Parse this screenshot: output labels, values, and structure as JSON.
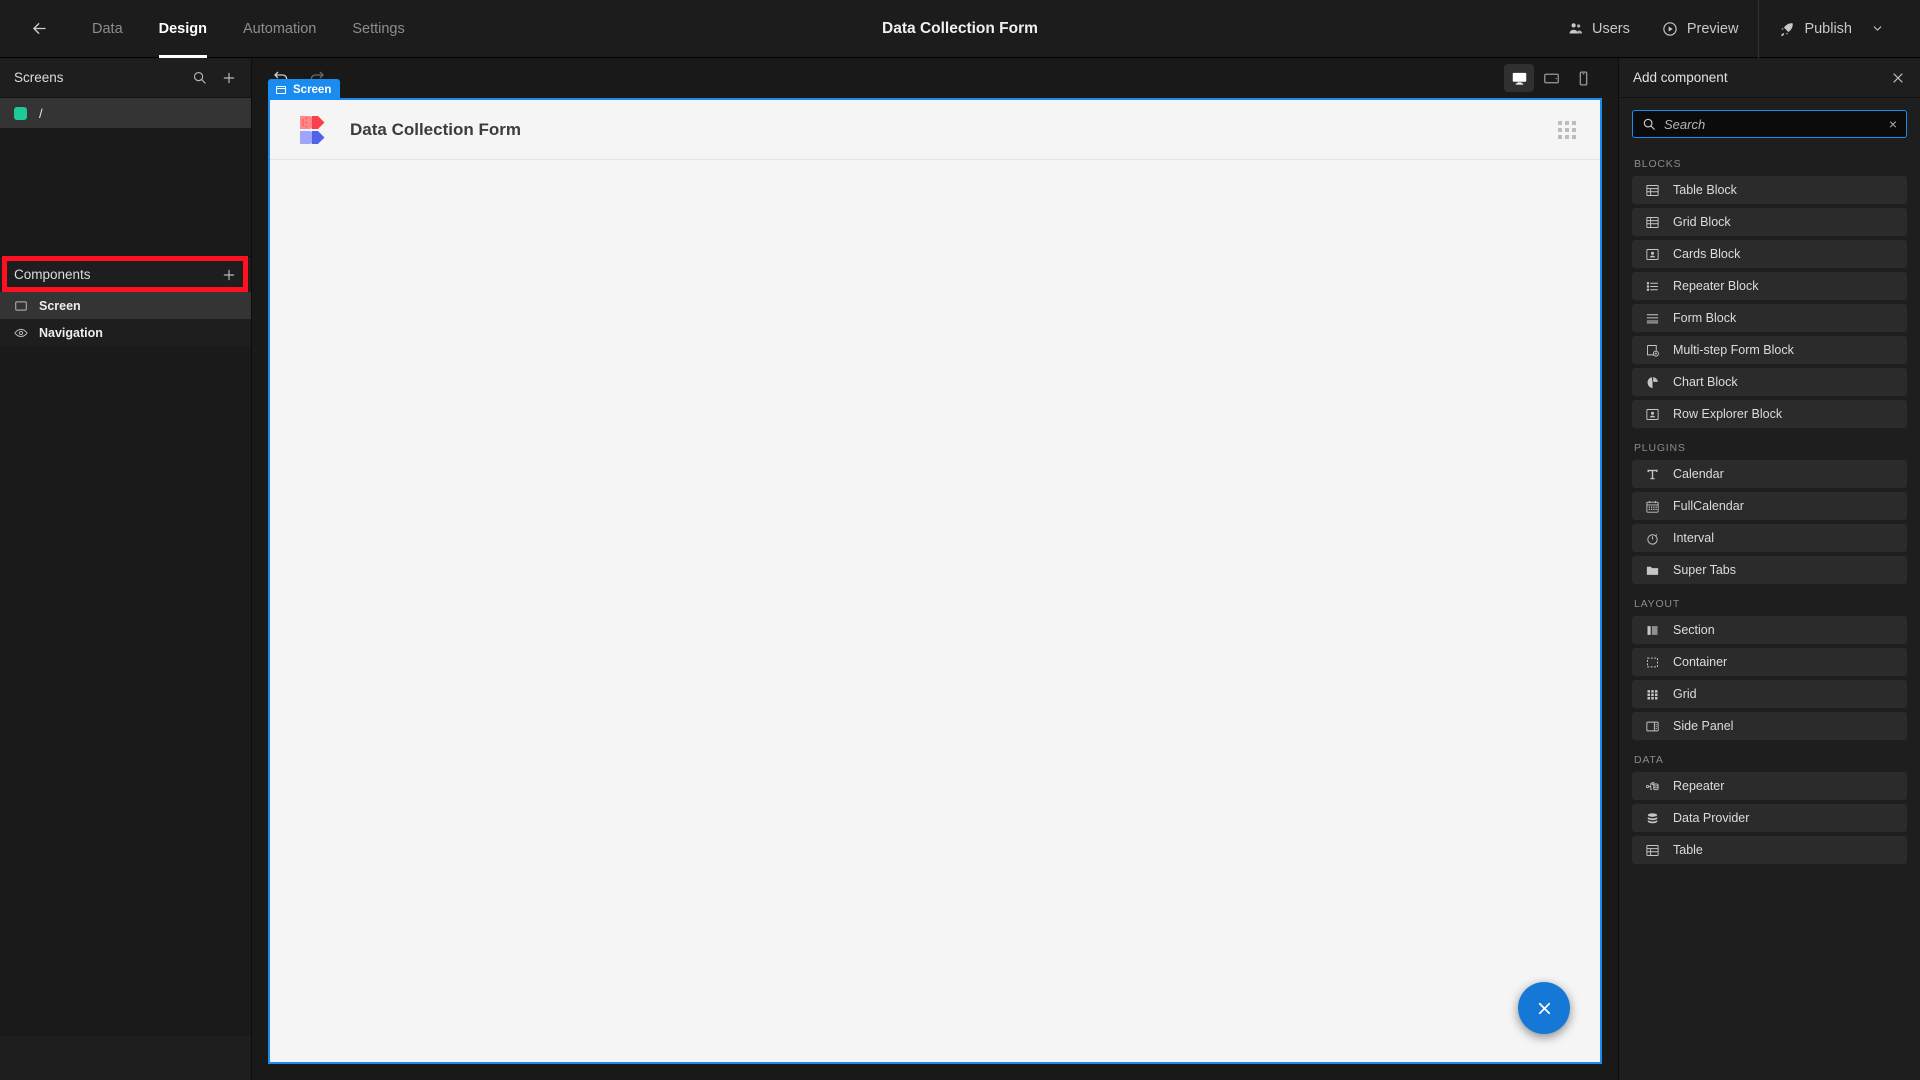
{
  "topbar": {
    "back_icon": "arrow-left-icon",
    "tabs": [
      {
        "label": "Data",
        "active": false
      },
      {
        "label": "Design",
        "active": true
      },
      {
        "label": "Automation",
        "active": false
      },
      {
        "label": "Settings",
        "active": false
      }
    ],
    "title": "Data Collection Form",
    "users_label": "Users",
    "preview_label": "Preview",
    "publish_label": "Publish"
  },
  "left_panel": {
    "screens_title": "Screens",
    "screens": [
      {
        "route": "/",
        "color": "#1ec997",
        "selected": true
      }
    ],
    "components_title": "Components",
    "components": [
      {
        "label": "Screen",
        "icon": "screen-icon",
        "selected": true
      },
      {
        "label": "Navigation",
        "icon": "eye-icon",
        "selected": false
      }
    ]
  },
  "canvas": {
    "undo_label": "Undo",
    "redo_label": "Redo",
    "devices": [
      {
        "name": "desktop",
        "active": true
      },
      {
        "name": "tablet",
        "active": false
      },
      {
        "name": "mobile",
        "active": false
      }
    ],
    "screen_badge": "Screen",
    "screen_title": "Data Collection Form",
    "fab_icon": "close-icon"
  },
  "right_panel": {
    "title": "Add component",
    "search": {
      "value": "",
      "placeholder": "Search"
    },
    "groups": [
      {
        "label": "BLOCKS",
        "items": [
          {
            "label": "Table Block",
            "icon": "table-icon"
          },
          {
            "label": "Grid Block",
            "icon": "grid-table-icon"
          },
          {
            "label": "Cards Block",
            "icon": "card-icon"
          },
          {
            "label": "Repeater Block",
            "icon": "list-icon"
          },
          {
            "label": "Form Block",
            "icon": "form-icon"
          },
          {
            "label": "Multi-step Form Block",
            "icon": "multistep-form-icon"
          },
          {
            "label": "Chart Block",
            "icon": "pie-chart-icon"
          },
          {
            "label": "Row Explorer Block",
            "icon": "card-icon"
          }
        ]
      },
      {
        "label": "PLUGINS",
        "items": [
          {
            "label": "Calendar",
            "icon": "text-t-icon"
          },
          {
            "label": "FullCalendar",
            "icon": "calendar-icon"
          },
          {
            "label": "Interval",
            "icon": "stopwatch-icon"
          },
          {
            "label": "Super Tabs",
            "icon": "folder-icon"
          }
        ]
      },
      {
        "label": "LAYOUT",
        "items": [
          {
            "label": "Section",
            "icon": "section-icon"
          },
          {
            "label": "Container",
            "icon": "container-dashed-icon"
          },
          {
            "label": "Grid",
            "icon": "grid-dots-icon"
          },
          {
            "label": "Side Panel",
            "icon": "side-panel-icon"
          }
        ]
      },
      {
        "label": "DATA",
        "items": [
          {
            "label": "Repeater",
            "icon": "repeater-data-icon"
          },
          {
            "label": "Data Provider",
            "icon": "database-icon"
          },
          {
            "label": "Table",
            "icon": "table-icon"
          }
        ]
      }
    ]
  },
  "colors": {
    "accent_blue": "#1a8cf0",
    "fab_blue": "#1577d6",
    "screen_dot_green": "#1ec997",
    "highlight_red": "#ff1122"
  }
}
